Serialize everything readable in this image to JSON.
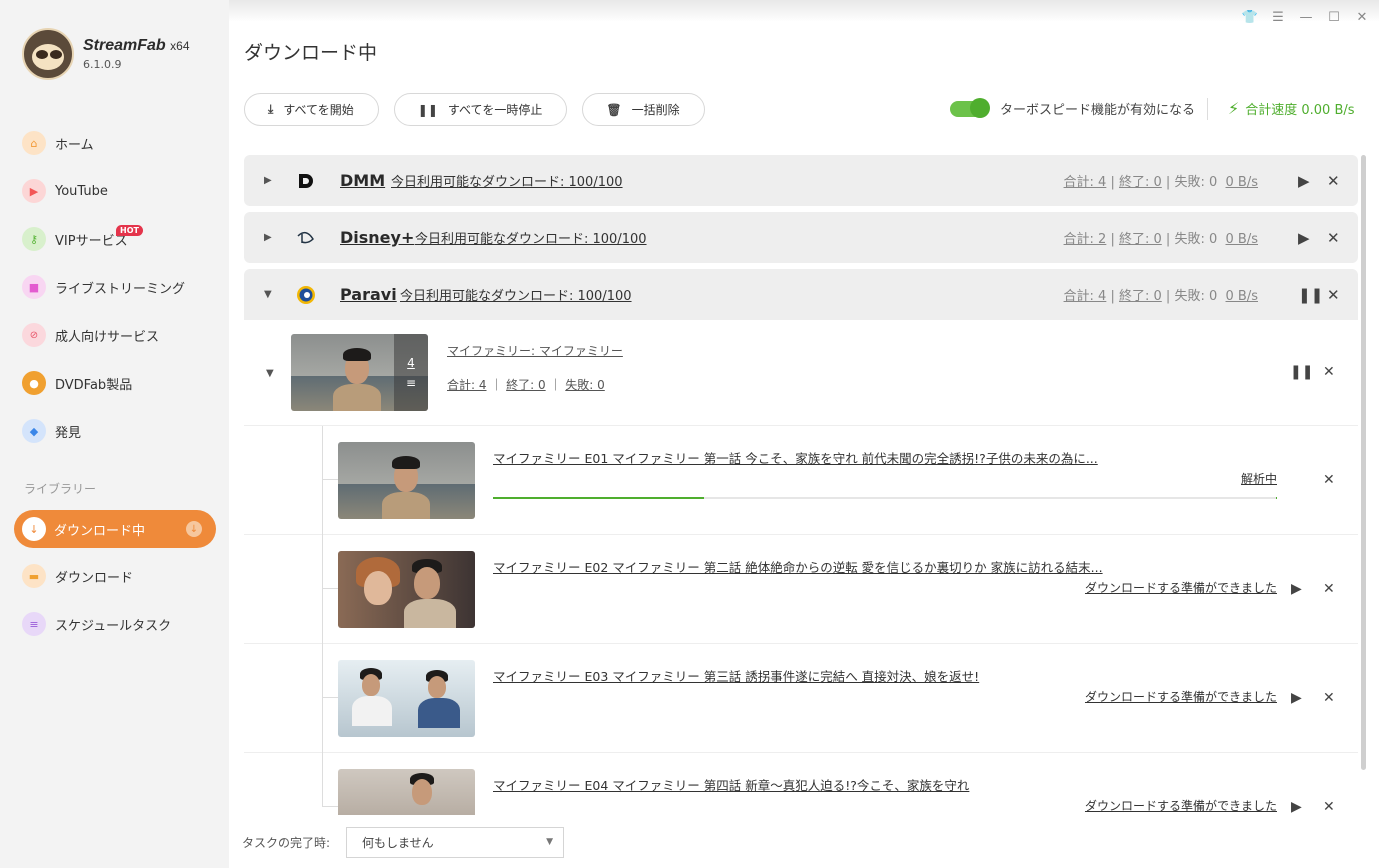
{
  "app": {
    "name": "StreamFab",
    "arch": "x64",
    "version": "6.1.0.9"
  },
  "sidebar": {
    "items": [
      {
        "label": "ホーム",
        "icon": "home-icon",
        "color": "#f29a38"
      },
      {
        "label": "YouTube",
        "icon": "youtube-icon",
        "color": "#f25656"
      },
      {
        "label": "VIPサービス",
        "icon": "key-icon",
        "color": "#5ab53a",
        "badge": "HOT"
      },
      {
        "label": "ライブストリーミング",
        "icon": "camera-icon",
        "color": "#e35bd0"
      },
      {
        "label": "成人向けサービス",
        "icon": "adult-icon",
        "color": "#e8556a"
      },
      {
        "label": "DVDFab製品",
        "icon": "dvdfab-icon",
        "color": "#f0a030"
      },
      {
        "label": "発見",
        "icon": "discover-icon",
        "color": "#3a86e8"
      }
    ],
    "library_title": "ライブラリー",
    "library": [
      {
        "label": "ダウンロード中",
        "icon": "download-icon",
        "active": true
      },
      {
        "label": "ダウンロード",
        "icon": "folder-icon",
        "color": "#f0a030"
      },
      {
        "label": "スケジュールタスク",
        "icon": "schedule-icon",
        "color": "#9a5bd8"
      }
    ]
  },
  "page": {
    "title": "ダウンロード中"
  },
  "toolbar": {
    "start_all": "すべてを開始",
    "pause_all": "すべてを一時停止",
    "delete_all": "一括削除",
    "turbo_label": "ターボスピード機能が有効になる",
    "speed_label": "合計速度 0.00 B/s"
  },
  "services": [
    {
      "name": "DMM",
      "quota": "今日利用可能なダウンロード: 100/100",
      "total": "合計: 4",
      "done": "終了: 0",
      "failed": "失敗: 0",
      "speed": "0 B/s"
    },
    {
      "name": "Disney+",
      "quota": "今日利用可能なダウンロード: 100/100",
      "total": "合計: 2",
      "done": "終了: 0",
      "failed": "失敗: 0",
      "speed": "0 B/s"
    },
    {
      "name": "Paravi",
      "quota": "今日利用可能なダウンロード: 100/100",
      "total": "合計: 4",
      "done": "終了: 0",
      "failed": "失敗: 0",
      "speed": "0 B/s"
    }
  ],
  "series": {
    "title": "マイファミリー: マイファミリー",
    "count": "4",
    "total": "合計: 4",
    "done": "終了: 0",
    "failed": "失敗: 0"
  },
  "episodes": [
    {
      "title": "マイファミリー E01 マイファミリー 第一話 今こそ、家族を守れ 前代未聞の完全誘拐!?子供の未来の為に...",
      "status": "解析中",
      "progress": 0.27
    },
    {
      "title": "マイファミリー E02 マイファミリー 第二話 絶体絶命からの逆転 愛を信じるか裏切りか 家族に訪れる結末...",
      "status": "ダウンロードする準備ができました"
    },
    {
      "title": "マイファミリー E03 マイファミリー 第三話 誘拐事件遂に完結へ 直接対決、娘を返せ!",
      "status": "ダウンロードする準備ができました"
    },
    {
      "title": "マイファミリー E04 マイファミリー 第四話 新章～真犯人迫る!?今こそ、家族を守れ",
      "status": "ダウンロードする準備ができました"
    }
  ],
  "footer": {
    "label": "タスクの完了時:",
    "select_value": "何もしません"
  },
  "colors": {
    "accent": "#ef8a3a",
    "green": "#4fae2e"
  }
}
